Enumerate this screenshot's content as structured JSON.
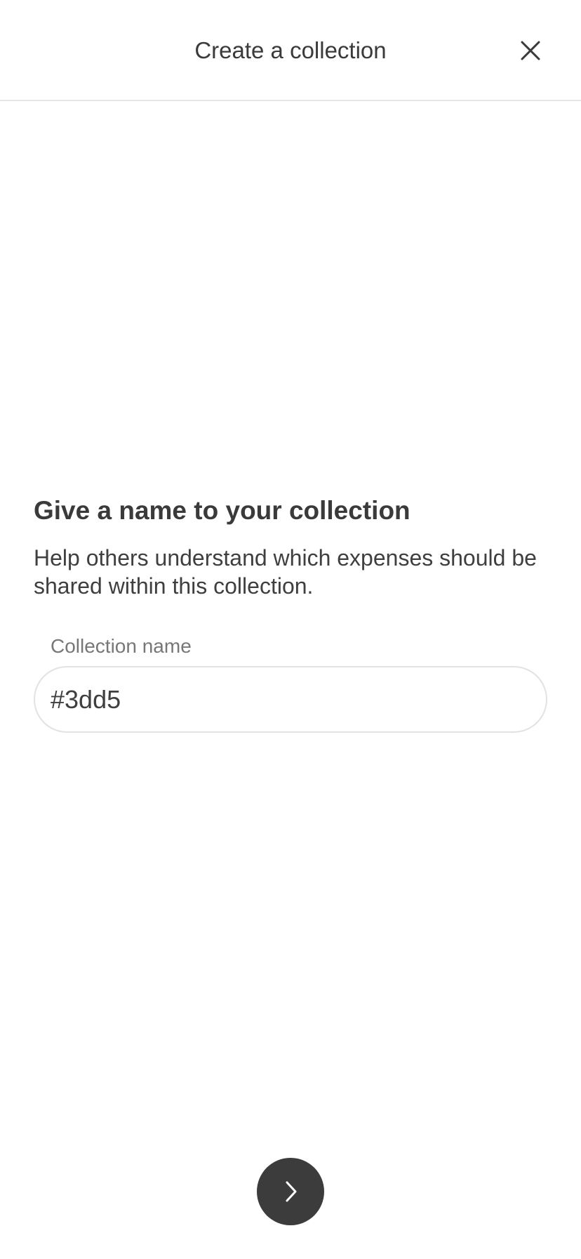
{
  "header": {
    "title": "Create a collection",
    "close_icon": "close-icon"
  },
  "main": {
    "heading": "Give a name to your collection",
    "description": "Help others understand which expenses should be shared within this collection.",
    "collection_name_field": {
      "label": "Collection name",
      "value": "#3dd5",
      "placeholder": ""
    }
  },
  "footer": {
    "next_icon": "chevron-right-icon",
    "button_color": "#3c3c3c"
  }
}
